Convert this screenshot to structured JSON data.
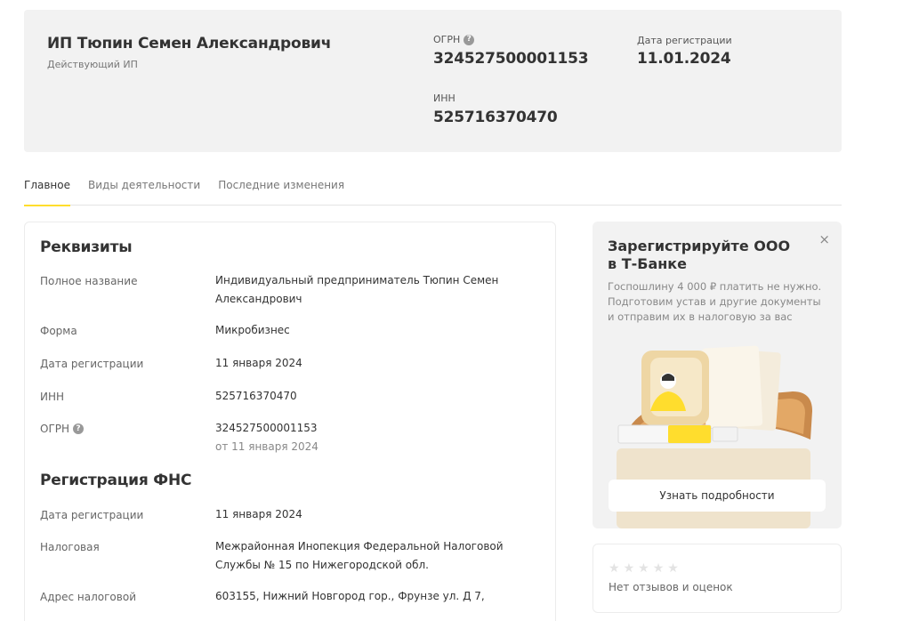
{
  "header": {
    "company_name": "ИП Тюпин Семен Александрович",
    "status": "Действующий ИП",
    "ogrn_label": "ОГРН",
    "ogrn_value": "324527500001153",
    "reg_date_label": "Дата регистрации",
    "reg_date_value": "11.01.2024",
    "inn_label": "ИНН",
    "inn_value": "525716370470"
  },
  "tabs": [
    {
      "label": "Главное",
      "active": true
    },
    {
      "label": "Виды деятельности",
      "active": false
    },
    {
      "label": "Последние изменения",
      "active": false
    }
  ],
  "requisites": {
    "title": "Реквизиты",
    "rows": [
      {
        "label": "Полное название",
        "value": "Индивидуальный предприниматель Тюпин Семен Александрович"
      },
      {
        "label": "Форма",
        "value": "Микробизнес"
      },
      {
        "label": "Дата регистрации",
        "value": "11 января 2024"
      },
      {
        "label": "ИНН",
        "value": "525716370470"
      },
      {
        "label": "ОГРН",
        "value": "324527500001153",
        "sub": "от 11 января 2024"
      }
    ]
  },
  "fns": {
    "title": "Регистрация ФНС",
    "rows": [
      {
        "label": "Дата регистрации",
        "value": "11 января 2024"
      },
      {
        "label": "Налоговая",
        "value": "Межрайонная Инопекция Федеральной Налоговой Службы № 15 по Нижегородской обл."
      },
      {
        "label": "Адрес налоговой",
        "value": "603155, Нижний Новгород гор., Фрунзе ул. Д 7,"
      }
    ]
  },
  "promo": {
    "title": "Зарегистрируйте ООО в Т‑Банке",
    "text": "Госпошлину 4 000 ₽ платить не нужно. Подготовим устав и другие документы и отправим их в налоговую за вас",
    "button_label": "Узнать подробности",
    "close_glyph": "×",
    "accent_color": "#ffdd2d"
  },
  "reviews": {
    "text": "Нет отзывов и оценок",
    "star_glyph": "★"
  },
  "icons": {
    "help_glyph": "?"
  }
}
